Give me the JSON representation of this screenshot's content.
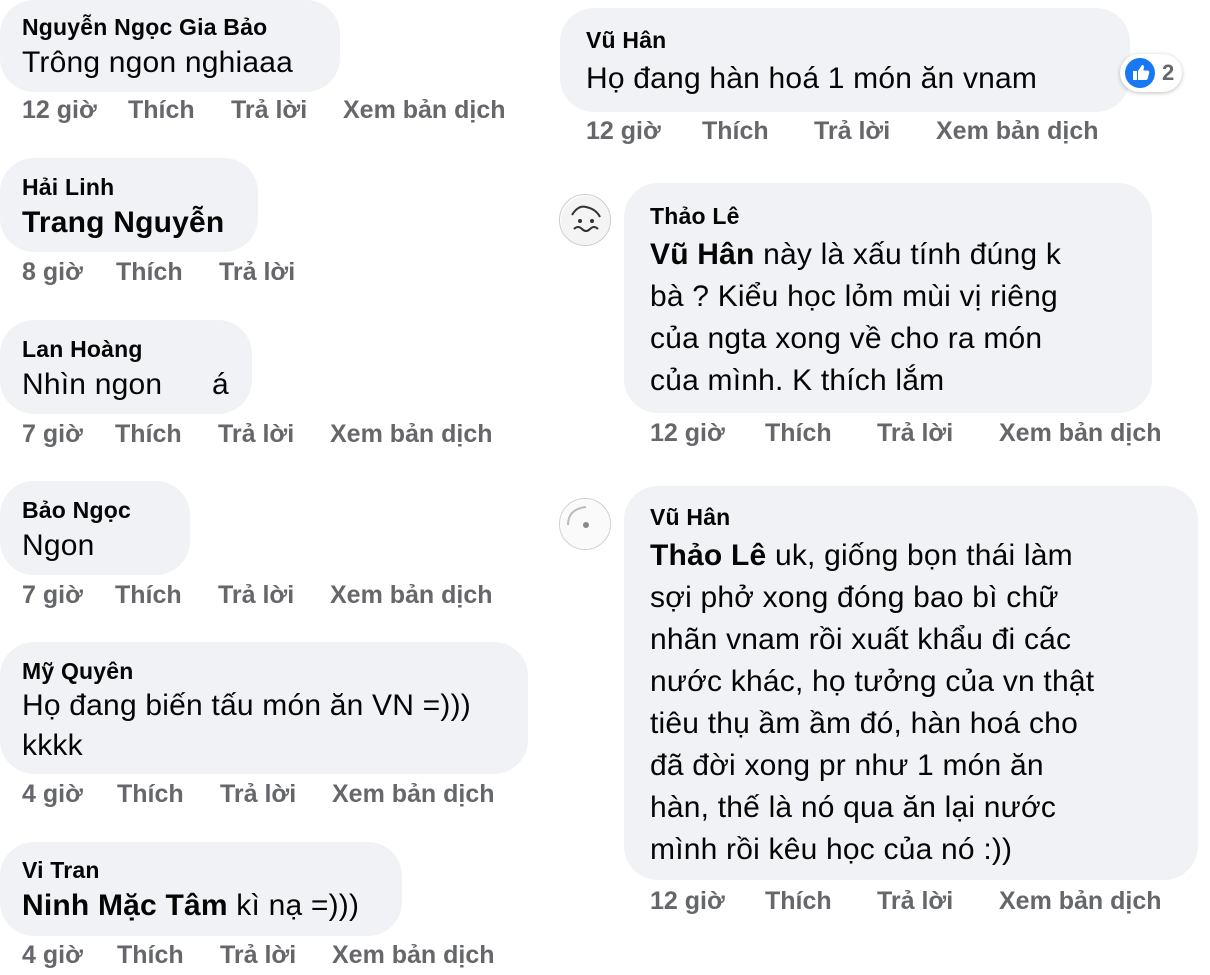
{
  "left_comments": [
    {
      "author": "Nguyễn Ngọc Gia Bảo",
      "text": "Trông ngon nghiaaa",
      "time": "12 giờ",
      "like": "Thích",
      "reply": "Trả lời",
      "translate": "Xem bản dịch"
    },
    {
      "author": "Hải Linh",
      "mention": "Trang Nguyễn",
      "time": "8 giờ",
      "like": "Thích",
      "reply": "Trả lời"
    },
    {
      "author": "Lan Hoàng",
      "text": "Nhìn ngon",
      "text_tail": "á",
      "time": "7 giờ",
      "like": "Thích",
      "reply": "Trả lời",
      "translate": "Xem bản dịch"
    },
    {
      "author": "Bảo Ngọc",
      "text": "Ngon",
      "time": "7 giờ",
      "like": "Thích",
      "reply": "Trả lời",
      "translate": "Xem bản dịch"
    },
    {
      "author": "Mỹ Quyên",
      "text_line1": "Họ đang biến tấu món ăn VN =)))",
      "text_line2": "kkkk",
      "time": "4 giờ",
      "like": "Thích",
      "reply": "Trả lời",
      "translate": "Xem bản dịch"
    },
    {
      "author": "Vi Tran",
      "mention": "Ninh Mặc Tâm",
      "text": " kì nạ =)))",
      "time": "4 giờ",
      "like": "Thích",
      "reply": "Trả lời",
      "translate": "Xem bản dịch"
    }
  ],
  "right_comments": [
    {
      "author": "Vũ Hân",
      "text": "Họ đang hàn hoá 1 món ăn vnam",
      "reaction_count": "2",
      "time": "12 giờ",
      "like": "Thích",
      "reply": "Trả lời",
      "translate": "Xem bản dịch"
    },
    {
      "author": "Thảo Lê",
      "mention": "Vũ Hân",
      "text_line1": " này là xấu tính đúng k",
      "text_line2": "bà ? Kiểu học lỏm mùi vị riêng",
      "text_line3": "của ngta xong về cho ra món",
      "text_line4": "của mình. K thích lắm",
      "time": "12 giờ",
      "like": "Thích",
      "reply": "Trả lời",
      "translate": "Xem bản dịch"
    },
    {
      "author": "Vũ Hân",
      "mention": "Thảo Lê",
      "text_line1": " uk, giống bọn thái làm",
      "text_line2": "sợi phở xong đóng bao bì chữ",
      "text_line3": "nhãn vnam rồi xuất khẩu đi các",
      "text_line4": "nước khác, họ tưởng của vn thật",
      "text_line5": "tiêu thụ ầm ầm đó, hàn hoá cho",
      "text_line6": "đã đời xong pr như 1 món ăn",
      "text_line7": "hàn, thế là nó qua ăn lại nước",
      "text_line8": "mình rồi kêu học của nó :))",
      "time": "12 giờ",
      "like": "Thích",
      "reply": "Trả lời",
      "translate": "Xem bản dịch"
    }
  ],
  "colors": {
    "bubble": "#f0f2f5",
    "meta_text": "#65676b",
    "like_blue": "#1877f2"
  },
  "icons": {
    "reaction": "thumbs-up-icon",
    "avatar_thao": "avatar-sketch-icon",
    "avatar_vu": "avatar-circle-icon"
  }
}
